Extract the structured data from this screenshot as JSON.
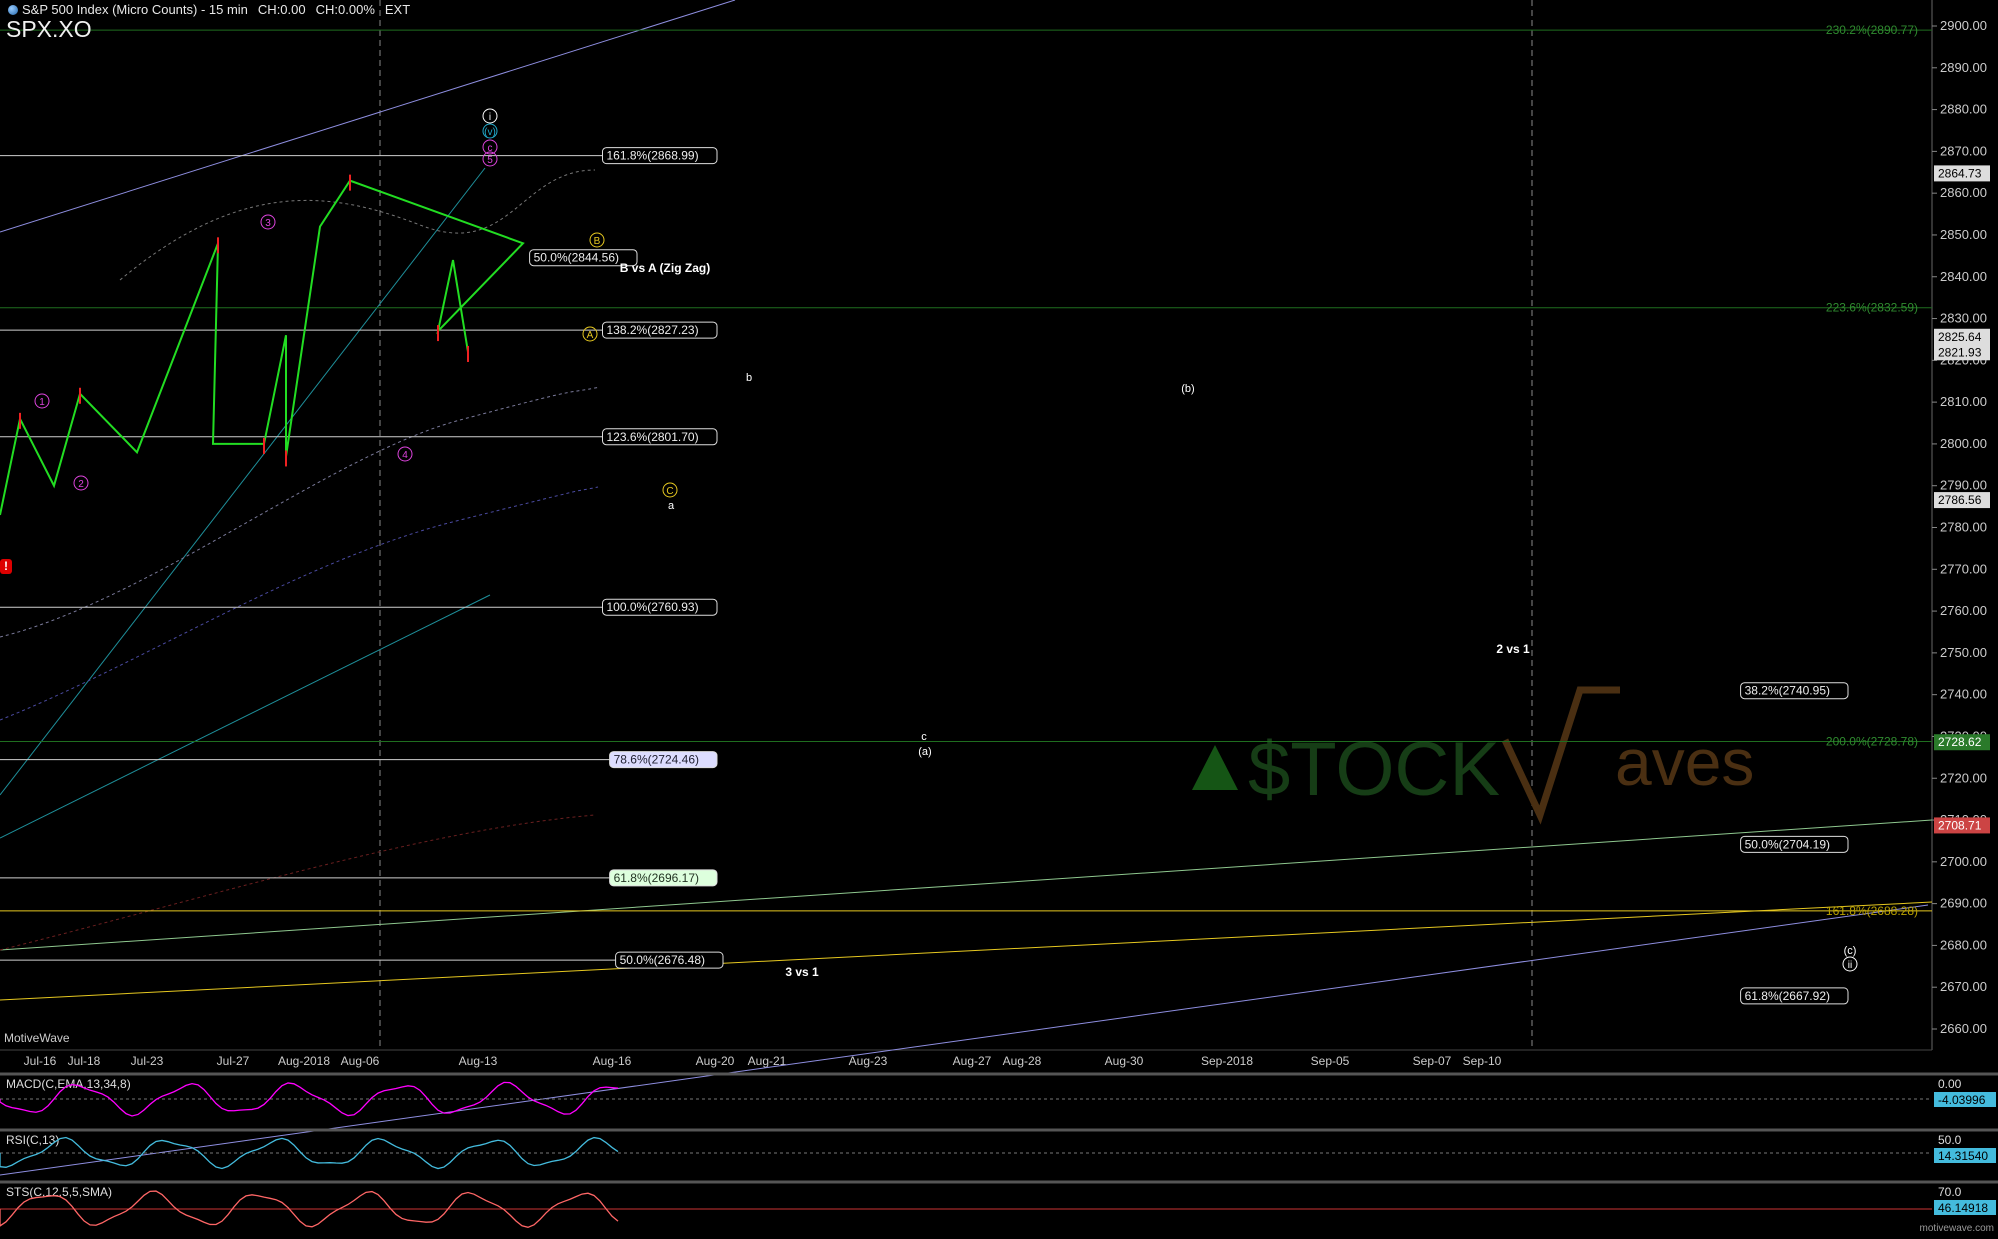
{
  "header": {
    "instrument": "S&P 500 Index (Micro Counts) - 15 min",
    "change": "CH:0.00",
    "change_pct": "CH:0.00%",
    "session": "EXT",
    "symbol": "SPX.XO"
  },
  "brand": "MotiveWave",
  "footer": "motivewave.com",
  "watermark": {
    "left": "$TOCK",
    "right": "aves",
    "w": "W"
  },
  "colors": {
    "up": "#22dd22",
    "down": "#ee2222",
    "fib_white": "#cfcfcf",
    "fib_green": "#1f6e1f",
    "channel": "#8e8ee0",
    "teal": "#1e8f9a",
    "magenta": "#dd44dd",
    "yellow": "#e6c820"
  },
  "chart_data": {
    "type": "line",
    "title": "S&P 500 Index (Micro Counts) - 15 min",
    "ylim": [
      2652,
      2905
    ],
    "y_ticks": [
      2660,
      2670,
      2680,
      2690,
      2700,
      2710,
      2720,
      2730,
      2740,
      2750,
      2760,
      2770,
      2780,
      2790,
      2800,
      2810,
      2820,
      2830,
      2840,
      2850,
      2860,
      2870,
      2880,
      2890,
      2900
    ],
    "x_ticks": [
      "Jul-16",
      "Jul-18",
      "Jul-23",
      "Jul-27",
      "Aug-2018",
      "Aug-06",
      "Aug-13",
      "Aug-16",
      "Aug-20",
      "Aug-21",
      "Aug-23",
      "Aug-27",
      "Aug-28",
      "Aug-30",
      "Sep-2018",
      "Sep-05",
      "Sep-07",
      "Sep-10"
    ],
    "price_path": [
      [
        "Jul-16",
        2783
      ],
      [
        "Jul-16",
        2806
      ],
      [
        "Jul-18",
        2790
      ],
      [
        "Jul-18",
        2812
      ],
      [
        "Jul-23",
        2798
      ],
      [
        "Jul-27",
        2848
      ],
      [
        "Jul-27",
        2800
      ],
      [
        "Aug-2018",
        2800
      ],
      [
        "Aug-2018",
        2826
      ],
      [
        "Aug-2018",
        2797
      ],
      [
        "Aug-06",
        2852
      ],
      [
        "Aug-06",
        2863
      ],
      [
        "Aug-13",
        2848
      ],
      [
        "Aug-13",
        2827
      ],
      [
        "Aug-13",
        2844
      ],
      [
        "Aug-13",
        2822
      ]
    ],
    "fib_levels": [
      {
        "label": "161.8%(2868.99)",
        "value": 2868.99
      },
      {
        "label": "50.0%(2844.56)",
        "value": 2844.56
      },
      {
        "label": "138.2%(2827.23)",
        "value": 2827.23
      },
      {
        "label": "123.6%(2801.70)",
        "value": 2801.7
      },
      {
        "label": "100.0%(2760.93)",
        "value": 2760.93
      },
      {
        "label": "78.6%(2724.46)",
        "value": 2724.46
      },
      {
        "label": "61.8%(2696.17)",
        "value": 2696.17
      },
      {
        "label": "50.0%(2676.48)",
        "value": 2676.48
      },
      {
        "label": "38.2%(2740.95)",
        "value": 2740.95
      },
      {
        "label": "50.0%(2704.19)",
        "value": 2704.19
      },
      {
        "label": "61.8%(2667.92)",
        "value": 2667.92
      }
    ],
    "ext_levels": [
      {
        "label": "230.2%(2890.77)",
        "value": 2899
      },
      {
        "label": "223.6%(2832.59)",
        "value": 2832.59
      },
      {
        "label": "200.0%(2728.78)",
        "value": 2728.78
      },
      {
        "label": "161.8%(2688.28)",
        "value": 2688.28
      }
    ],
    "price_tags": [
      {
        "label": "2864.73",
        "value": 2864.73
      },
      {
        "label": "2825.64",
        "value": 2825.64
      },
      {
        "label": "2821.93",
        "value": 2821.93
      },
      {
        "label": "2786.56",
        "value": 2786.56
      },
      {
        "label": "2728.62",
        "value": 2728.62
      },
      {
        "label": "2708.71",
        "value": 2708.71
      }
    ],
    "annotations": [
      "B vs A (Zig Zag)",
      "2 vs 1",
      "3 vs 1",
      "b",
      "(b)",
      "a",
      "c",
      "(a)",
      "(c)",
      "i",
      "ii",
      "(v)",
      "c",
      "A",
      "B",
      "C",
      "1",
      "2",
      "3",
      "4",
      "5"
    ],
    "indicators": [
      {
        "name": "MACD(C,EMA,13,34,8)",
        "values": [
          "0.00",
          "-4.03996"
        ]
      },
      {
        "name": "RSI(C,13)",
        "values": [
          "50.0",
          "14.31540"
        ]
      },
      {
        "name": "STS(C,12,5,5,SMA)",
        "values": [
          "70.0",
          "46.14918"
        ]
      }
    ]
  }
}
